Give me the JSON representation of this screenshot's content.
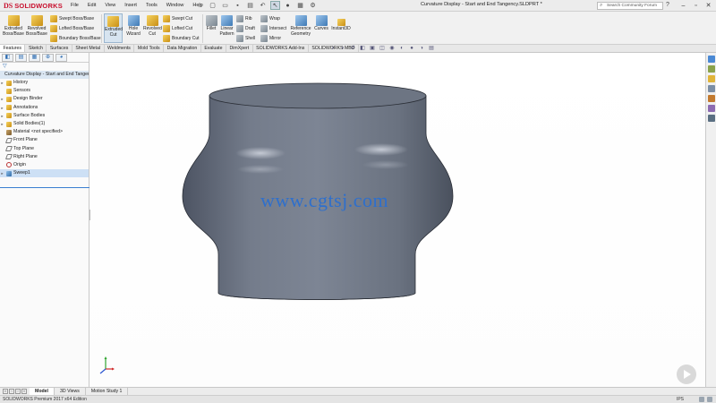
{
  "app": {
    "logo_text": "SOLIDWORKS",
    "logo_mark": "DS",
    "document_title": "Curvature Display - Start and End Tangency.SLDPRT *",
    "search_placeholder": "Search Community Forum"
  },
  "menu": [
    "File",
    "Edit",
    "View",
    "Insert",
    "Tools",
    "Window",
    "Help"
  ],
  "ribbon": {
    "extruded_boss": "Extruded Boss/Base",
    "revolved_boss": "Revolved Boss/Base",
    "swept_boss": "Swept Boss/Base",
    "lofted_boss": "Lofted Boss/Base",
    "boundary_boss": "Boundary Boss/Base",
    "extruded_cut": "Extruded Cut",
    "hole_wizard": "Hole Wizard",
    "revolved_cut": "Revolved Cut",
    "swept_cut": "Swept Cut",
    "lofted_cut": "Lofted Cut",
    "boundary_cut": "Boundary Cut",
    "fillet": "Fillet",
    "linear_pattern": "Linear Pattern",
    "rib": "Rib",
    "draft": "Draft",
    "shell": "Shell",
    "wrap": "Wrap",
    "intersect": "Intersect",
    "mirror": "Mirror",
    "reference_geometry": "Reference Geometry",
    "curves": "Curves",
    "instant3d": "Instant3D"
  },
  "command_tabs": [
    "Features",
    "Sketch",
    "Surfaces",
    "Sheet Metal",
    "Weldments",
    "Mold Tools",
    "Data Migration",
    "Evaluate",
    "DimXpert",
    "SOLIDWORKS Add-Ins",
    "SOLIDWORKS MBD"
  ],
  "active_command_tab": "Features",
  "tree": {
    "root": "Curvature Display - Start and End Tangency",
    "items": [
      {
        "label": "History",
        "icon": "history-icon",
        "expandable": true
      },
      {
        "label": "Sensors",
        "icon": "sensor-icon",
        "expandable": false
      },
      {
        "label": "Design Binder",
        "icon": "design-binder-icon",
        "expandable": true
      },
      {
        "label": "Annotations",
        "icon": "annotations-icon",
        "expandable": true
      },
      {
        "label": "Surface Bodies",
        "icon": "surface-bodies-icon",
        "expandable": true
      },
      {
        "label": "Solid Bodies(1)",
        "icon": "solid-bodies-icon",
        "expandable": true
      },
      {
        "label": "Material <not specified>",
        "icon": "material-icon",
        "expandable": false
      },
      {
        "label": "Front Plane",
        "icon": "plane-icon",
        "expandable": false
      },
      {
        "label": "Top Plane",
        "icon": "plane-icon",
        "expandable": false
      },
      {
        "label": "Right Plane",
        "icon": "plane-icon",
        "expandable": false
      },
      {
        "label": "Origin",
        "icon": "origin-icon",
        "expandable": false
      },
      {
        "label": "Sweep1",
        "icon": "sweep-icon",
        "expandable": true,
        "selected": true
      }
    ]
  },
  "watermark": "www.cgtsj.com",
  "bottom_tabs": [
    "Model",
    "3D Views",
    "Motion Study 1"
  ],
  "active_bottom_tab": "Model",
  "status": {
    "edition": "SOLIDWORKS Premium 2017 x64 Edition",
    "units": "IPS"
  },
  "colors": {
    "model_fill": "#6e7684",
    "model_edge": "#2a2e36",
    "watermark": "#2e6fcc",
    "brand": "#c8102e",
    "selection": "#cde0f5"
  }
}
